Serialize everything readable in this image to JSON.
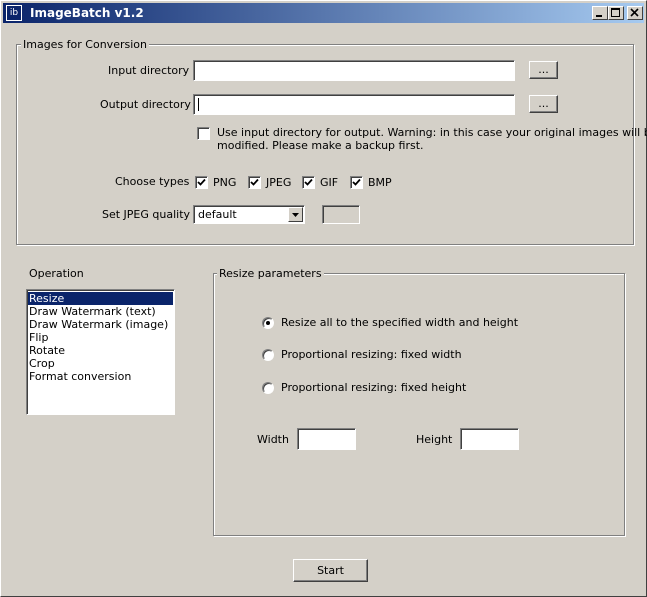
{
  "window": {
    "title": "ImageBatch v1.2",
    "icon_text": "ib",
    "controls": [
      "minimize-icon",
      "maximize-icon",
      "close-icon"
    ]
  },
  "images_group": {
    "legend": "Images for Conversion",
    "input_label": "Input directory",
    "input_value": "",
    "output_label": "Output directory",
    "output_value": "",
    "browse_label": "...",
    "use_input_label_line1": "Use input directory for output. Warning: in this case your original images will be",
    "use_input_label_line2": "modified. Please make a backup first.",
    "use_input_checked": false,
    "types_label": "Choose types",
    "types": [
      {
        "label": "PNG",
        "checked": true
      },
      {
        "label": "JPEG",
        "checked": true
      },
      {
        "label": "GIF",
        "checked": true
      },
      {
        "label": "BMP",
        "checked": true
      }
    ],
    "jpeg_quality_label": "Set JPEG quality",
    "jpeg_quality_value": "default",
    "jpeg_quality_number": ""
  },
  "operation": {
    "label": "Operation",
    "items": [
      {
        "label": "Resize",
        "selected": true
      },
      {
        "label": "Draw Watermark (text)",
        "selected": false
      },
      {
        "label": "Draw Watermark (image)",
        "selected": false
      },
      {
        "label": "Flip",
        "selected": false
      },
      {
        "label": "Rotate",
        "selected": false
      },
      {
        "label": "Crop",
        "selected": false
      },
      {
        "label": "Format conversion",
        "selected": false
      }
    ]
  },
  "resize_group": {
    "legend": "Resize parameters",
    "options": [
      {
        "label": "Resize all to the specified width and height",
        "selected": true
      },
      {
        "label": "Proportional resizing: fixed width",
        "selected": false
      },
      {
        "label": "Proportional resizing: fixed height",
        "selected": false
      }
    ],
    "width_label": "Width",
    "width_value": "",
    "height_label": "Height",
    "height_value": ""
  },
  "start_label": "Start",
  "colors": {
    "face": "#d4d0c8",
    "title_start": "#0a246a",
    "title_end": "#a6caf0",
    "selection": "#0a246a"
  }
}
